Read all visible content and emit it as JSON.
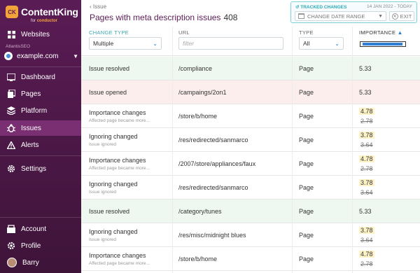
{
  "app": {
    "logo_mark": "CK",
    "name": "ContentKing",
    "sub_prefix": "for",
    "sub_brand": "conductor"
  },
  "sidebar": {
    "websites_label": "Websites",
    "team_label": "AtlantisSEO",
    "site_name": "example.com",
    "items": [
      {
        "label": "Dashboard",
        "icon": "dashboard-icon"
      },
      {
        "label": "Pages",
        "icon": "pages-icon"
      },
      {
        "label": "Platform",
        "icon": "platform-icon"
      },
      {
        "label": "Issues",
        "icon": "issues-icon"
      },
      {
        "label": "Alerts",
        "icon": "alerts-icon"
      },
      {
        "label": "Settings",
        "icon": "gear-icon"
      }
    ],
    "bottom": [
      {
        "label": "Account",
        "icon": "account-icon"
      },
      {
        "label": "Profile",
        "icon": "profile-icon"
      },
      {
        "label": "Barry",
        "icon": "avatar"
      }
    ],
    "active_item": "Issues"
  },
  "header": {
    "back_label": "Issue",
    "title": "Pages with meta description issues",
    "count": "408"
  },
  "tracked": {
    "label": "TRACKED CHANGES",
    "range": "14 JAN 2022 - TODAY",
    "change_date_label": "CHANGE DATE RANGE",
    "exit_label": "EXIT"
  },
  "columns": {
    "change_type": {
      "label": "CHANGE TYPE",
      "filter_value": "Multiple"
    },
    "url": {
      "label": "URL",
      "filter_placeholder": "filter"
    },
    "type": {
      "label": "TYPE",
      "filter_value": "All"
    },
    "importance": {
      "label": "IMPORTANCE",
      "sort_icon": "sort-asc-icon",
      "filter_level": 0.05
    }
  },
  "colors": {
    "resolved_bg": "#eef8f1",
    "opened_bg": "#fdeeee",
    "sidebar_bg": "#4c1847",
    "accent": "#2aa9b4"
  },
  "rows": [
    {
      "change": "Issue resolved",
      "sub": "",
      "url": "/compliance",
      "type": "Page",
      "imp": "5.33",
      "imp_old": "",
      "status": "resolved"
    },
    {
      "change": "Issue opened",
      "sub": "",
      "url": "/campaings/2on1",
      "type": "Page",
      "imp": "5.33",
      "imp_old": "",
      "status": "opened"
    },
    {
      "change": "Importance changes",
      "sub": "Affected page became more...",
      "url": "/store/b/home",
      "type": "Page",
      "imp": "4.78",
      "imp_old": "2.78",
      "status": "normal"
    },
    {
      "change": "Ignoring changed",
      "sub": "Issue ignored",
      "url": "/res/redirected/sanmarco",
      "type": "Page",
      "imp": "3.78",
      "imp_old": "3.64",
      "status": "normal"
    },
    {
      "change": "Importance changes",
      "sub": "Affected page became more...",
      "url": "/2007/store/appliances/faux",
      "type": "Page",
      "imp": "4.78",
      "imp_old": "2.78",
      "status": "normal"
    },
    {
      "change": "Ignoring changed",
      "sub": "Issue ignored",
      "url": "/res/redirected/sanmarco",
      "type": "Page",
      "imp": "3.78",
      "imp_old": "3.64",
      "status": "normal"
    },
    {
      "change": "Issue resolved",
      "sub": "",
      "url": "/category/tunes",
      "type": "Page",
      "imp": "5.33",
      "imp_old": "",
      "status": "resolved"
    },
    {
      "change": "Ignoring changed",
      "sub": "Issue ignored",
      "url": "/res/misc/midnight blues",
      "type": "Page",
      "imp": "3.78",
      "imp_old": "3.64",
      "status": "normal"
    },
    {
      "change": "Importance changes",
      "sub": "Affected page became more...",
      "url": "/store/b/home",
      "type": "Page",
      "imp": "4.78",
      "imp_old": "2.78",
      "status": "normal"
    }
  ]
}
